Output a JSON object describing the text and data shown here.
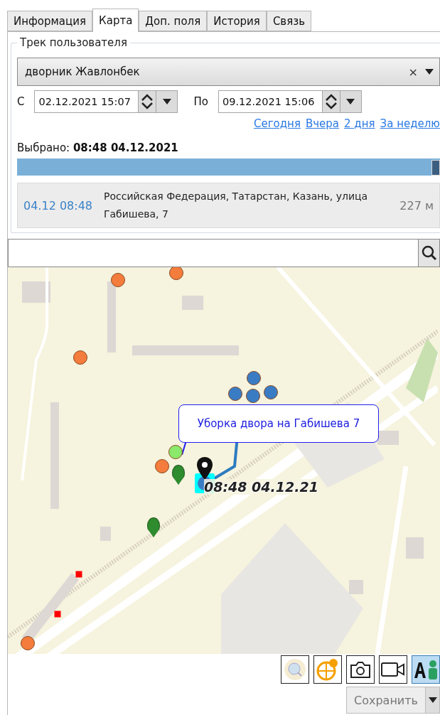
{
  "tabs": [
    {
      "label": "Информация",
      "selected": false
    },
    {
      "label": "Карта",
      "selected": true
    },
    {
      "label": "Доп. поля",
      "selected": false
    },
    {
      "label": "История",
      "selected": false
    },
    {
      "label": "Связь",
      "selected": false
    }
  ],
  "track": {
    "title": "Трек пользователя",
    "user": "дворник Жавлонбек",
    "clear": "×",
    "from_label": "С",
    "from": "02.12.2021 15:07",
    "to_label": "По",
    "to": "09.12.2021 15:06",
    "quick_links": [
      "Сегодня",
      "Вчера",
      "2 дня",
      "За неделю"
    ],
    "selected_label": "Выбрано:",
    "selected_value": "08:48 04.12.2021",
    "slider": {
      "level": 1
    },
    "point": {
      "time": "04.12 08:48",
      "address": "Российская Федерация, Татарстан, Казань, улица Габишева, 7",
      "distance": "227 м"
    }
  },
  "map": {
    "task_label": "Уборка двора на Габишева 7",
    "time_label": "08:48 04.12.21",
    "markers": [
      {
        "kind": "circle",
        "color": "#f47c3c"
      },
      {
        "kind": "circle",
        "color": "#f47c3c"
      },
      {
        "kind": "circle",
        "color": "#f47c3c"
      },
      {
        "kind": "circle",
        "color": "#f47c3c"
      },
      {
        "kind": "circle",
        "color": "#f47c3c"
      },
      {
        "kind": "circle",
        "color": "#3a7cc4"
      },
      {
        "kind": "circle",
        "color": "#3a7cc4"
      },
      {
        "kind": "circle",
        "color": "#3a7cc4"
      },
      {
        "kind": "circle",
        "color": "#3a7cc4"
      },
      {
        "kind": "circle",
        "color": "#8ae86a"
      },
      {
        "kind": "pin",
        "color": "#2e8b2e"
      },
      {
        "kind": "pin",
        "color": "#2e8b2e"
      },
      {
        "kind": "square",
        "color": "#ff0000"
      },
      {
        "kind": "square",
        "color": "#ff0000"
      }
    ]
  },
  "toolbar": [
    {
      "kind": "zoom",
      "on": false
    },
    {
      "kind": "globe",
      "on": false
    },
    {
      "kind": "camera",
      "on": false
    },
    {
      "kind": "video",
      "on": false
    },
    {
      "kind": "labels",
      "on": true
    }
  ],
  "save": "Сохранить"
}
